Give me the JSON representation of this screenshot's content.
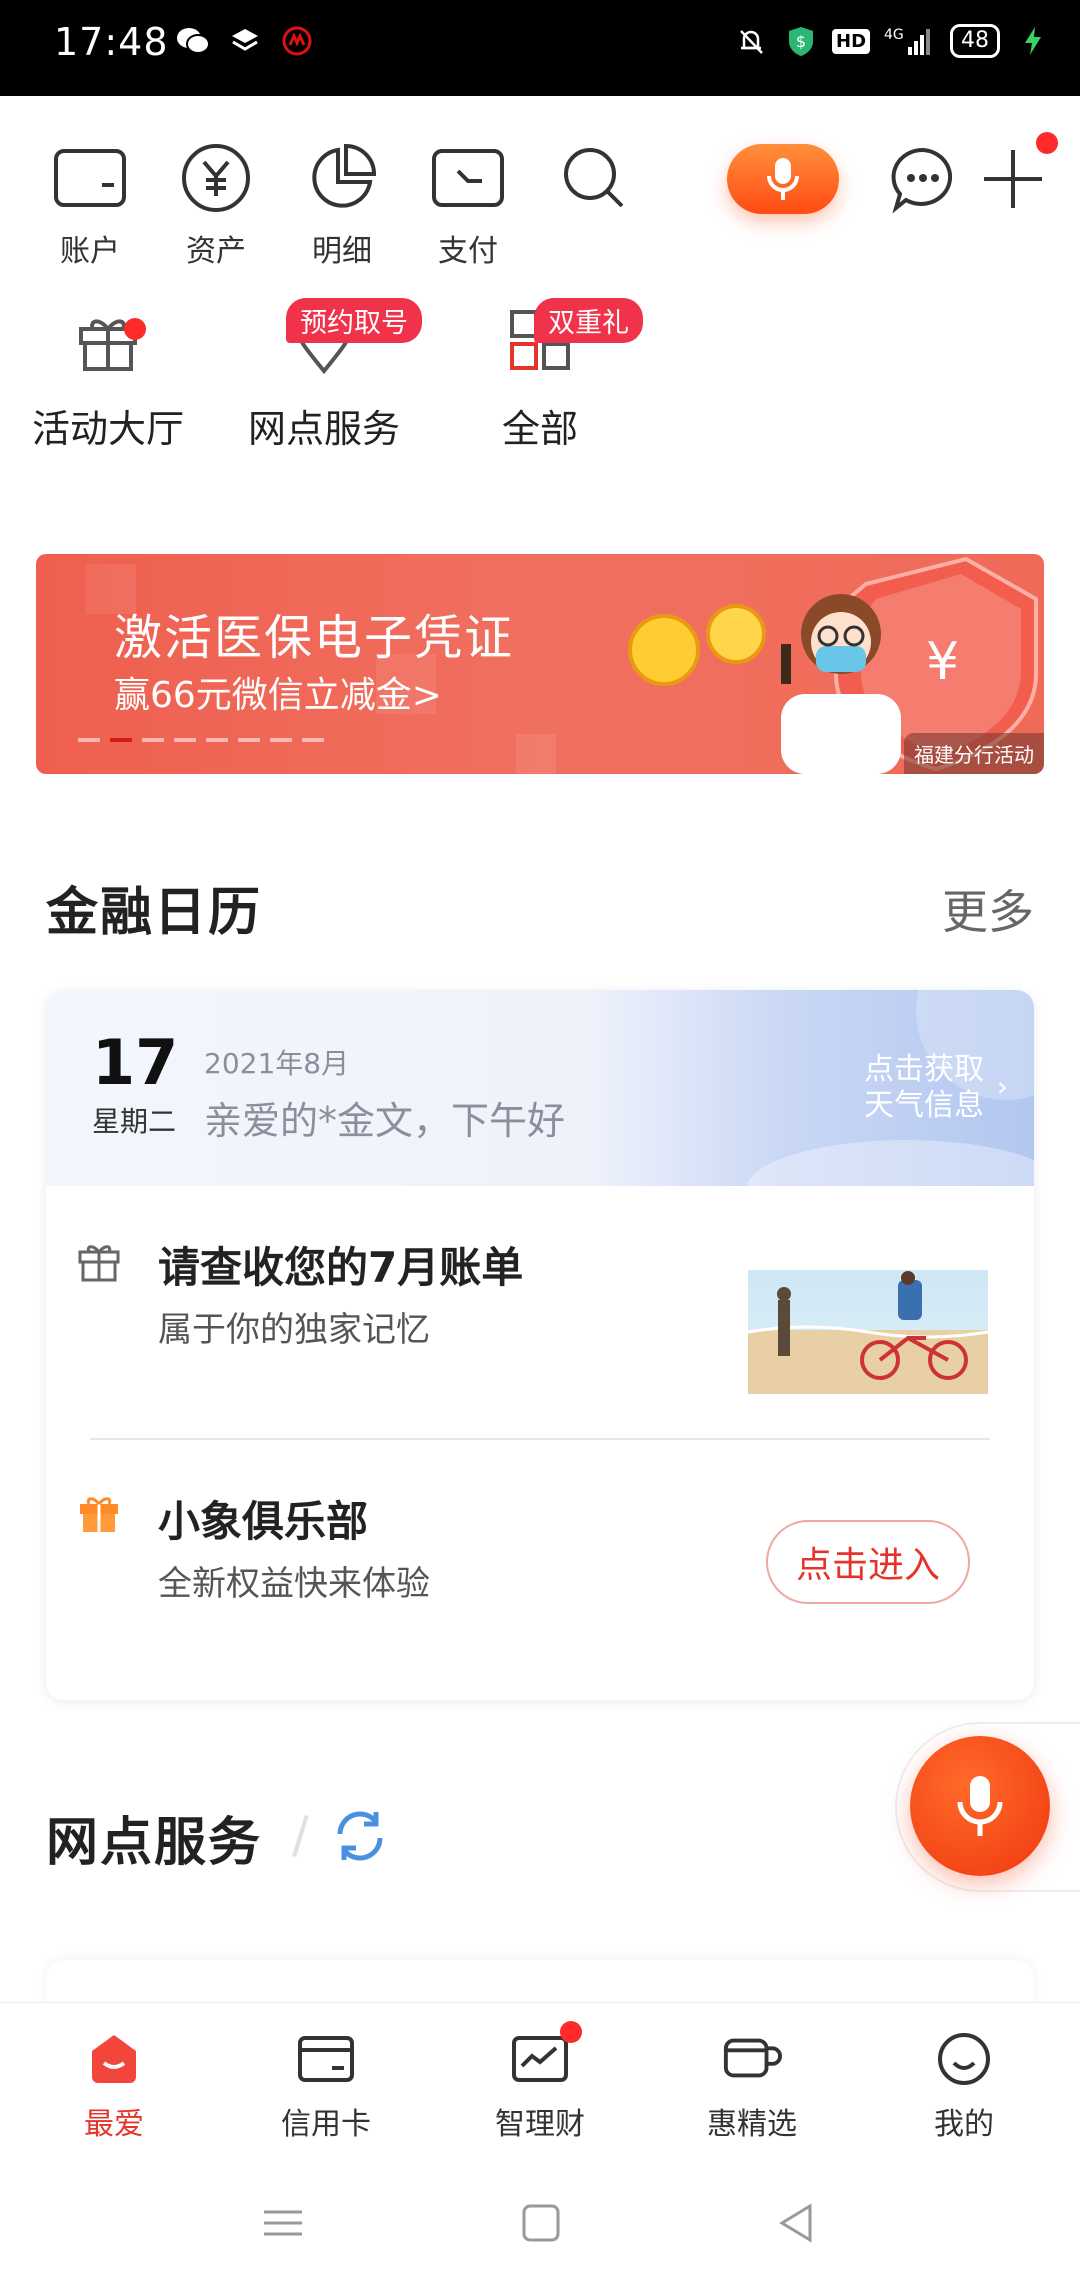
{
  "status_bar": {
    "time": "17:48",
    "battery": "48",
    "network": "4G",
    "hd": "HD"
  },
  "top_actions": [
    {
      "label": "账户",
      "icon": "wallet-icon"
    },
    {
      "label": "资产",
      "icon": "yuan-icon"
    },
    {
      "label": "明细",
      "icon": "pie-chart-icon"
    },
    {
      "label": "支付",
      "icon": "payment-icon"
    },
    {
      "label": "",
      "icon": "search-icon"
    }
  ],
  "shortcuts": [
    {
      "label": "活动大厅",
      "icon": "gift-icon",
      "tag": ""
    },
    {
      "label": "网点服务",
      "icon": "location-icon",
      "tag": "预约取号"
    },
    {
      "label": "全部",
      "icon": "grid-icon",
      "tag": "双重礼"
    }
  ],
  "banner": {
    "title": "激活医保电子凭证",
    "subtitle": "赢66元微信立减金>",
    "badge": "福建分行活动",
    "yuan_symbol": "¥"
  },
  "finance_calendar": {
    "title": "金融日历",
    "more": "更多",
    "day": "17",
    "weekday": "星期二",
    "month": "2021年8月",
    "greeting": "亲爱的*金文，下午好",
    "weather_line1": "点击获取",
    "weather_line2": "天气信息",
    "items": [
      {
        "title": "请查收您的7月账单",
        "subtitle": "属于你的独家记忆"
      },
      {
        "title": "小象俱乐部",
        "subtitle": "全新权益快来体验",
        "button": "点击进入"
      }
    ]
  },
  "branch_service": {
    "title": "网点服务"
  },
  "tabbar": [
    {
      "label": "最爱",
      "icon": "favorite-icon",
      "active": true
    },
    {
      "label": "信用卡",
      "icon": "credit-card-icon",
      "active": false
    },
    {
      "label": "智理财",
      "icon": "wealth-chart-icon",
      "active": false
    },
    {
      "label": "惠精选",
      "icon": "cup-icon",
      "active": false
    },
    {
      "label": "我的",
      "icon": "smiley-icon",
      "active": false
    }
  ],
  "colors": {
    "accent_red": "#e5342c",
    "orange": "#ff5a1f",
    "tag_red": "#f0334b"
  }
}
